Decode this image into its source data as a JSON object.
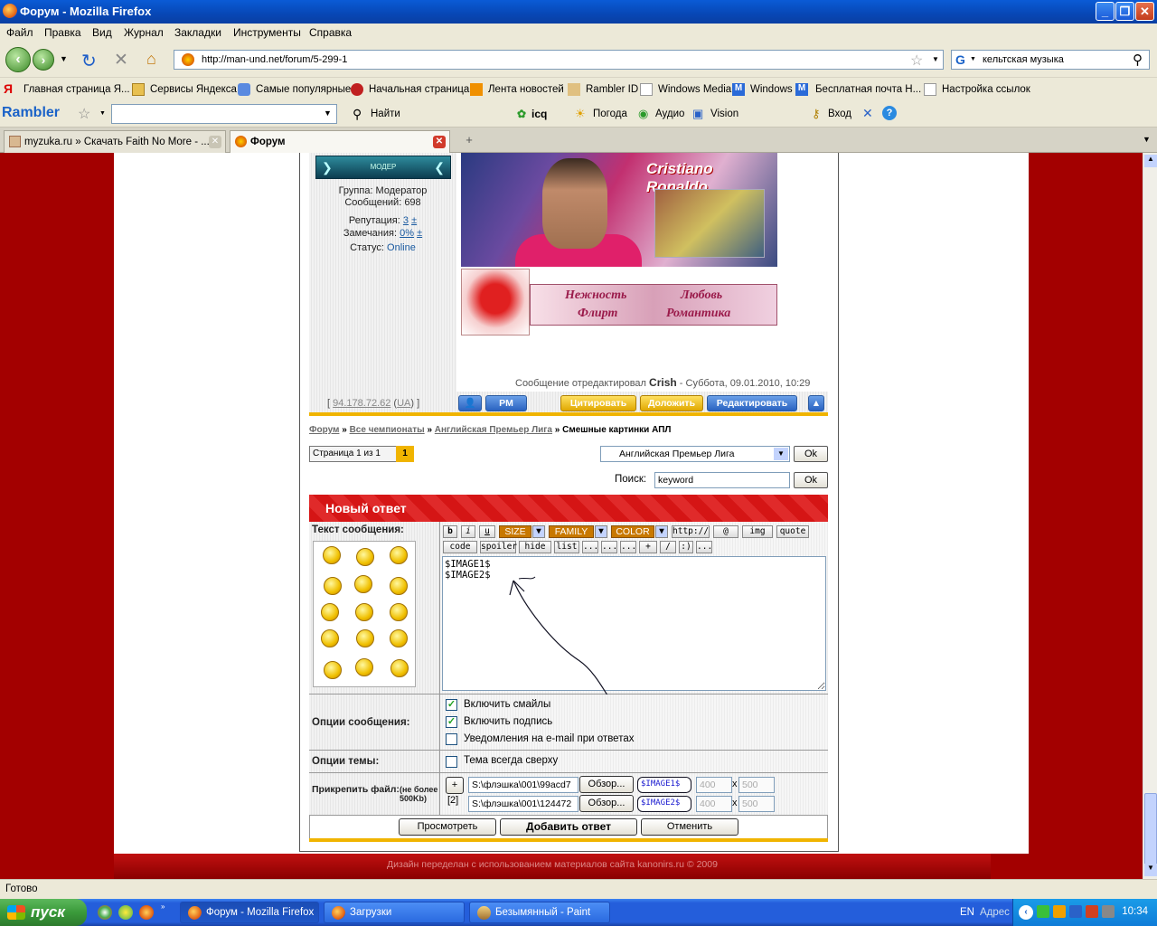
{
  "window": {
    "title": "Форум - Mozilla Firefox"
  },
  "menu": [
    "Файл",
    "Правка",
    "Вид",
    "Журнал",
    "Закладки",
    "Инструменты",
    "Справка"
  ],
  "nav": {
    "url": "http://man-und.net/forum/5-299-1",
    "search_value": "кельтская музыка"
  },
  "bookmarks": [
    "Главная страница Я...",
    "Сервисы Яндекса",
    "Самые популярные",
    "Начальная страница",
    "Лента новостей",
    "Rambler ID",
    "Windows Media",
    "Windows",
    "Бесплатная почта H...",
    "Настройка ссылок"
  ],
  "rambler": {
    "logo": "Rambler",
    "find": "Найти",
    "icq": "icq",
    "weather": "Погода",
    "audio": "Аудио",
    "vision": "Vision",
    "login": "Вход"
  },
  "tabs": [
    {
      "label": "myzuka.ru » Скачать Faith No More - ..."
    },
    {
      "label": "Форум"
    }
  ],
  "profile": {
    "rank": "МОДЕР",
    "group": "Группа: Модератор",
    "posts": "Сообщений: 698",
    "rep_label": "Репутация:",
    "rep_value": "3",
    "rep_pm": "±",
    "warn_label": "Замечания:",
    "warn_value": "0%",
    "warn_pm": "±",
    "status_label": "Статус:",
    "status_value": "Online",
    "ip": "94.178.72.62",
    "ip_country": "UA"
  },
  "signature": {
    "title": "Cristiano Ronaldo",
    "words": [
      "Нежность",
      "Любовь",
      "Флирт",
      "Романтика"
    ]
  },
  "edit_note": {
    "prefix": "Сообщение отредактировал",
    "user": "Crish",
    "suffix": "- Суббота, 09.01.2010, 10:29"
  },
  "actions": {
    "pm": "PM",
    "quote": "Цитировать",
    "report": "Доложить",
    "edit": "Редактировать"
  },
  "breadcrumb": {
    "home": "Форум",
    "sep": "»",
    "l1": "Все чемпионаты",
    "l2": "Английская Премьер Лига",
    "current": "Смешные картинки АПЛ"
  },
  "pager": {
    "label": "Страница 1 из 1",
    "current": "1"
  },
  "forum_select": "Английская Премьер Лига",
  "ok": "Ok",
  "search": {
    "label": "Поиск:",
    "value": "keyword"
  },
  "reply": {
    "title": "Новый ответ",
    "text_label": "Текст сообщения:",
    "bb_row1": [
      "b",
      "i",
      "u",
      "SIZE",
      "FAMILY",
      "COLOR",
      "http://",
      "@",
      "img",
      "quote"
    ],
    "bb_row2": [
      "code",
      "spoiler",
      "hide",
      "list",
      "...",
      "...",
      "...",
      "+",
      "/",
      ":)",
      "..."
    ],
    "message": "$IMAGE1$\n$IMAGE2$",
    "opts_label": "Опции сообщения:",
    "opt1": "Включить смайлы",
    "opt2": "Включить подпись",
    "opt3": "Уведомления на e-mail при ответах",
    "topic_label": "Опции темы:",
    "topic_opt": "Тема всегда сверху",
    "attach_label": "Прикрепить файл:",
    "attach_note": "(не более 500Kb)",
    "attach_count": "[2]",
    "add": "+",
    "files": [
      {
        "path": "S:\\флэшка\\001\\99acd7",
        "browse": "Обзор...",
        "tag": "$IMAGE1$",
        "w": "400",
        "h": "500"
      },
      {
        "path": "S:\\флэшка\\001\\124472",
        "browse": "Обзор...",
        "tag": "$IMAGE2$",
        "w": "400",
        "h": "500"
      }
    ],
    "x": "x",
    "preview": "Просмотреть",
    "submit": "Добавить ответ",
    "cancel": "Отменить"
  },
  "footer": "Дизайн переделан с использованием материалов сайта kanonirs.ru © 2009",
  "status": "Готово",
  "taskbar": {
    "start": "пуск",
    "tasks": [
      "Форум - Mozilla Firefox",
      "Загрузки",
      "Безымянный - Paint"
    ],
    "lang": "EN",
    "address": "Адрес",
    "clock": "10:34"
  }
}
